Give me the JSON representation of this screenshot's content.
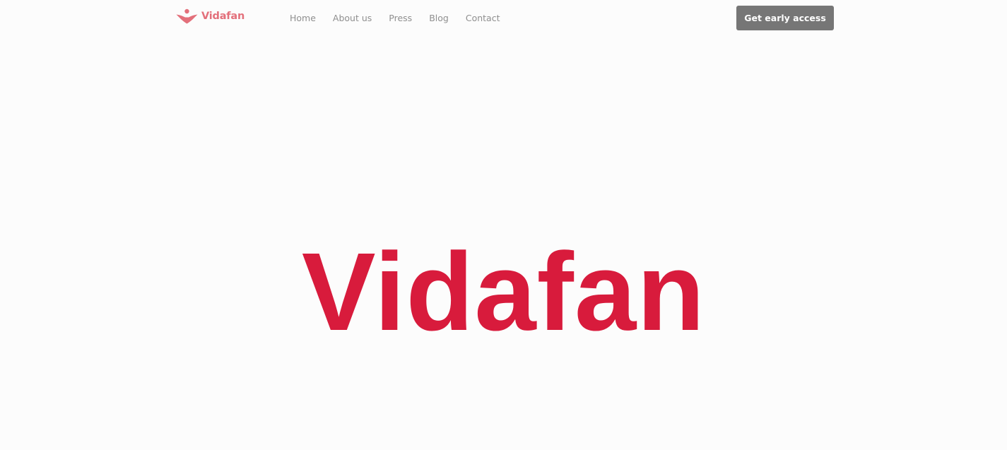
{
  "brand": {
    "name": "Vidafan",
    "logo_icon": "person-raised-arms-heart-icon",
    "color": "#e3707b"
  },
  "nav": {
    "items": [
      {
        "label": "Home"
      },
      {
        "label": "About us"
      },
      {
        "label": "Press"
      },
      {
        "label": "Blog"
      },
      {
        "label": "Contact"
      }
    ],
    "color": "#8f8f8f"
  },
  "cta": {
    "label": "Get early access",
    "background": "#767676",
    "text_color": "#ffffff"
  },
  "hero": {
    "title": "Vidafan",
    "color": "#d81b3c"
  },
  "page": {
    "background": "#fcfcfc"
  }
}
